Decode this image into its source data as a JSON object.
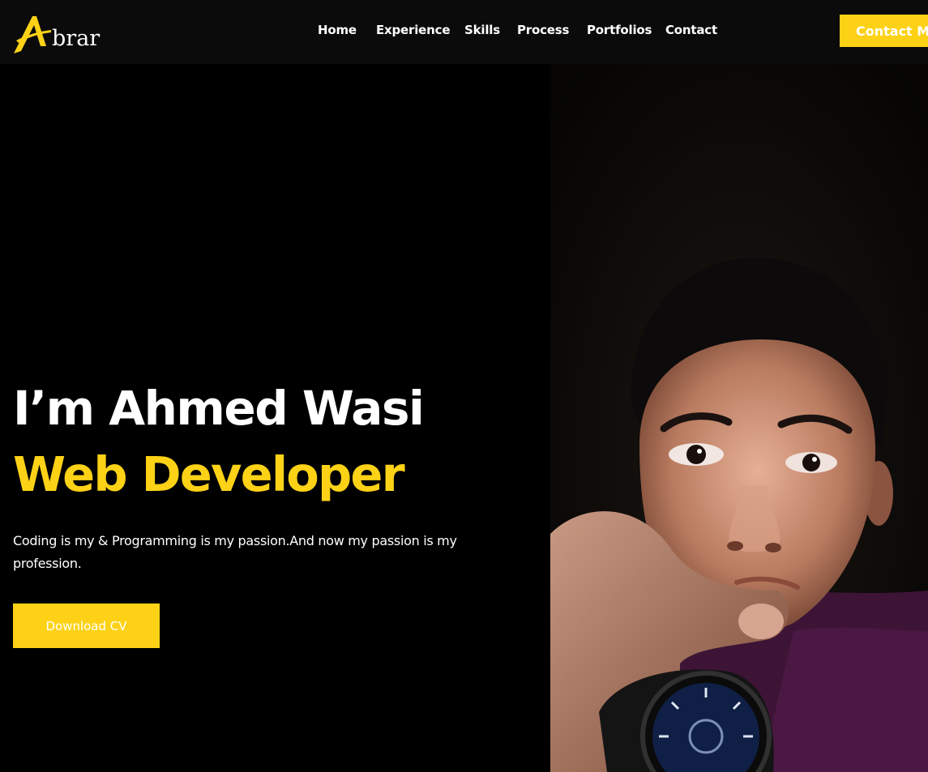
{
  "brand": {
    "logo_letter": "A",
    "logo_text": "brar",
    "accent_color": "#fdd216"
  },
  "nav": {
    "items": [
      {
        "label": "Home"
      },
      {
        "label": "Experience"
      },
      {
        "label": "Skills"
      },
      {
        "label": "Process"
      },
      {
        "label": "Portfolios"
      },
      {
        "label": "Contact"
      }
    ],
    "cta_label": "Contact Me"
  },
  "hero": {
    "title": "I’m Ahmed Wasi",
    "role": "Web Developer",
    "description": "Coding is my & Programming is my passion.And now my passion is my profession.",
    "button_label": "Download CV"
  }
}
